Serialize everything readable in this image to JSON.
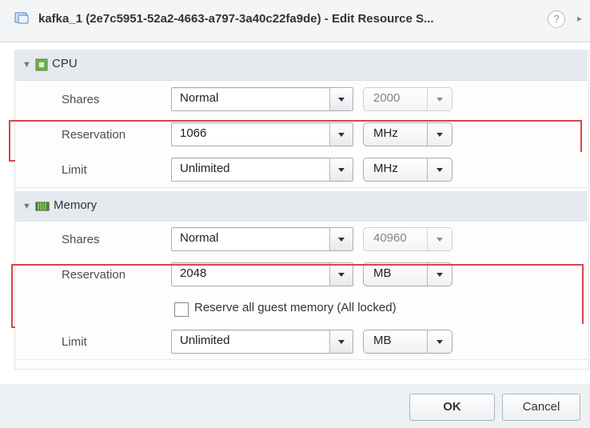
{
  "window": {
    "title": "kafka_1 (2e7c5951-52a2-4663-a797-3a40c22fa9de) - Edit Resource S...",
    "help_label": "?",
    "more_label": "▸"
  },
  "sections": {
    "cpu": {
      "label": "CPU",
      "shares": {
        "label": "Shares",
        "value": "Normal",
        "amount": "2000"
      },
      "reservation": {
        "label": "Reservation",
        "value": "1066",
        "unit": "MHz"
      },
      "limit": {
        "label": "Limit",
        "value": "Unlimited",
        "unit": "MHz"
      }
    },
    "memory": {
      "label": "Memory",
      "shares": {
        "label": "Shares",
        "value": "Normal",
        "amount": "40960"
      },
      "reservation": {
        "label": "Reservation",
        "value": "2048",
        "unit": "MB",
        "checkbox_label": "Reserve all guest memory (All locked)",
        "checked": false
      },
      "limit": {
        "label": "Limit",
        "value": "Unlimited",
        "unit": "MB"
      }
    }
  },
  "footer": {
    "ok_label": "OK",
    "cancel_label": "Cancel"
  },
  "colors": {
    "highlight": "#d94444",
    "section_background": "#e5eaee"
  },
  "icons": {
    "window": "vm-icon",
    "cpu": "cpu-icon",
    "memory": "memory-icon"
  }
}
